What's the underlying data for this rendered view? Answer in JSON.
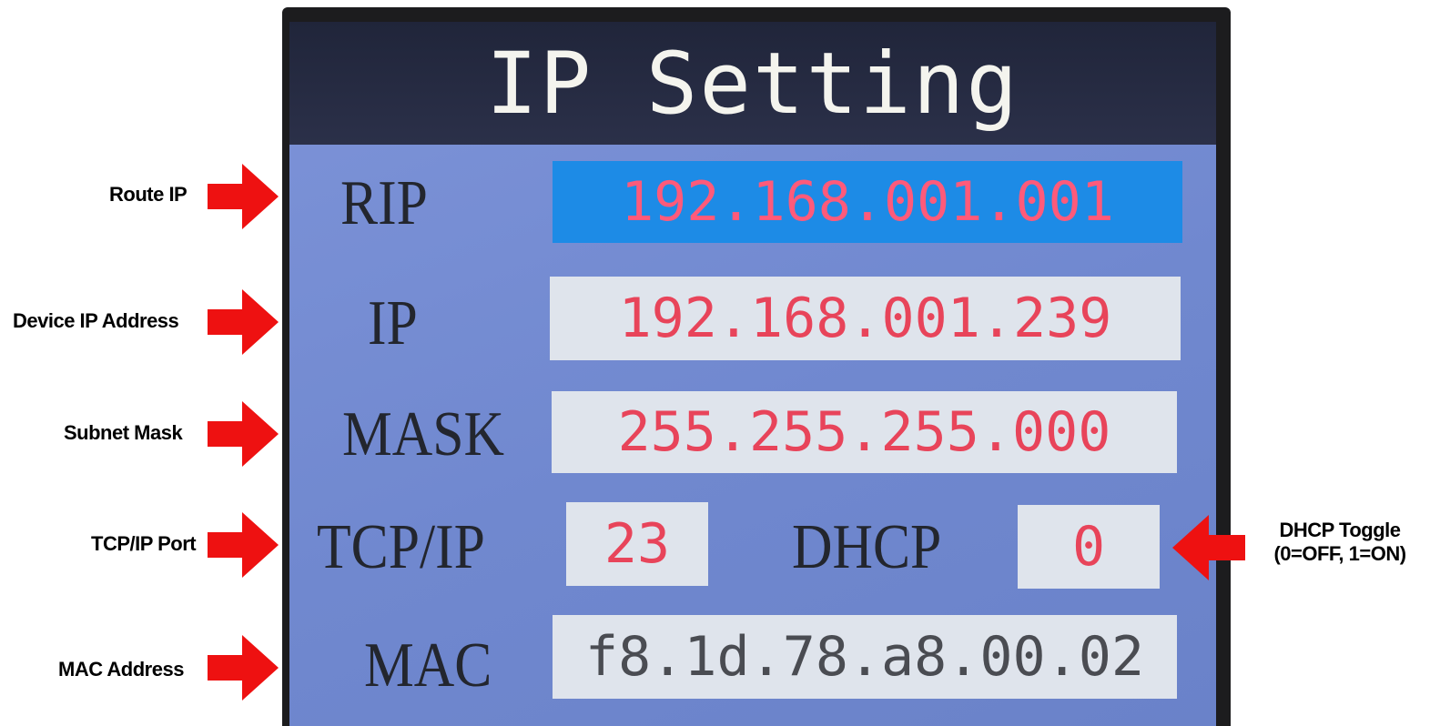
{
  "screen": {
    "title": "IP Setting",
    "rows": [
      {
        "label": "RIP",
        "value": "192.168.001.001",
        "selected": true
      },
      {
        "label": "IP",
        "value": "192.168.001.239"
      },
      {
        "label": "MASK",
        "value": "255.255.255.000"
      },
      {
        "label": "TCP/IP",
        "value": "23",
        "dhcp_label": "DHCP",
        "dhcp_value": "0"
      },
      {
        "label": "MAC",
        "value": "f8.1d.78.a8.00.02"
      }
    ]
  },
  "annotations": {
    "route_ip": "Route IP",
    "device_ip": "Device IP Address",
    "subnet_mask": "Subnet Mask",
    "tcp_port": "TCP/IP Port",
    "mac_address": "MAC Address",
    "dhcp_toggle_line1": "DHCP Toggle",
    "dhcp_toggle_line2": "(0=OFF,  1=ON)"
  },
  "colors": {
    "arrow": "#ee1111",
    "screen_bg": "#7088cf",
    "titlebar": "#23283e",
    "selected_field": "#1d8be6",
    "field_bg": "#dfe4ec",
    "value_text": "#e8445a"
  },
  "icons": {
    "left_annotation_arrows": "arrow-right-icon",
    "right_annotation_arrow": "arrow-left-icon"
  }
}
